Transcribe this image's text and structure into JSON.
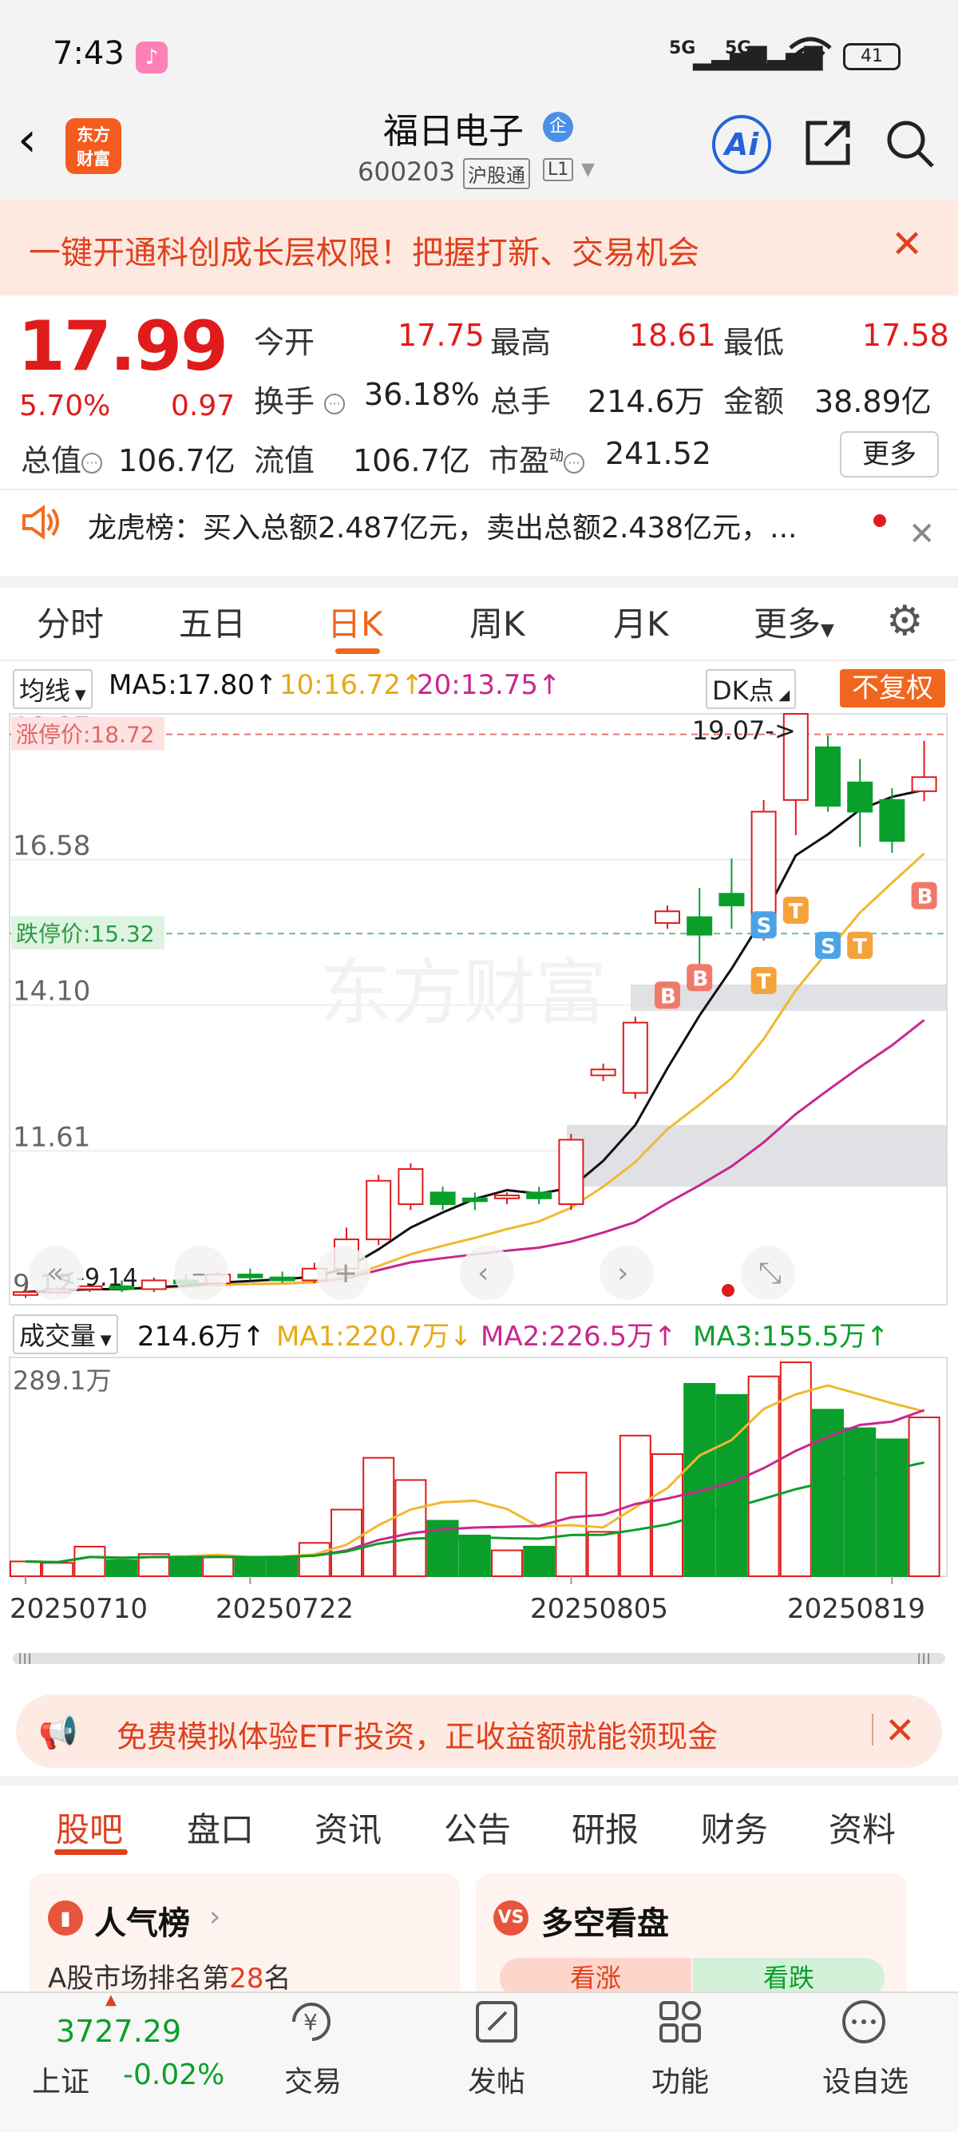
{
  "status": {
    "time": "7:43",
    "signal1": "5G",
    "signal2": "5G",
    "battery": "41"
  },
  "header": {
    "logo_line1": "东方",
    "logo_line2": "财富",
    "stock_name": "福日电子",
    "badge": "企",
    "stock_code": "600203",
    "tag_connect": "沪股通",
    "tag_level": "L1",
    "ai_label": "Ai"
  },
  "promo": {
    "text": "一键开通科创成长层权限！把握打新、交易机会"
  },
  "quote": {
    "price": "17.99",
    "pct_change": "5.70%",
    "change": "0.97",
    "open_label": "今开",
    "open": "17.75",
    "high_label": "最高",
    "high": "18.61",
    "low_label": "最低",
    "low": "17.58",
    "turnover_label": "换手",
    "turnover": "36.18%",
    "volume_label": "总手",
    "volume": "214.6万",
    "amount_label": "金额",
    "amount": "38.89亿",
    "mktcap_label": "总值",
    "mktcap": "106.7亿",
    "float_label": "流值",
    "float_cap": "106.7亿",
    "pe_label": "市盈",
    "pe_sup": "动",
    "pe": "241.52",
    "more_label": "更多"
  },
  "dragon": {
    "text": "龙虎榜：买入总额2.487亿元，卖出总额2.438亿元，..."
  },
  "ktabs": [
    "分时",
    "五日",
    "日K",
    "周K",
    "月K",
    "更多"
  ],
  "indicators": {
    "line_select": "均线",
    "ma5": "MA5:17.80↑",
    "ma10": "10:16.72↑",
    "ma20": "20:13.75↑",
    "dk": "DK点",
    "fq": "不复权"
  },
  "volume_ind": {
    "select": "成交量",
    "vol": "214.6万↑",
    "ma1": "MA1:220.7万↓",
    "ma2": "MA2:226.5万↑",
    "ma3": "MA3:155.5万↑",
    "max_label": "289.1万"
  },
  "chart_data": {
    "type": "candlestick",
    "price_ticks": [
      "19.07",
      "16.58",
      "14.10",
      "11.61",
      "9.12"
    ],
    "limit_up_label": "涨停价:18.72",
    "limit_down_label": "跌停价:15.32",
    "peak_label": "19.07->",
    "low_label": "<-9.14",
    "dates": [
      "20250710",
      "20250722",
      "20250805",
      "20250819"
    ],
    "candles": [
      {
        "o": 9.15,
        "c": 9.2,
        "h": 9.3,
        "l": 9.1,
        "v": 20
      },
      {
        "o": 9.2,
        "c": 9.25,
        "h": 9.3,
        "l": 9.15,
        "v": 18
      },
      {
        "o": 9.25,
        "c": 9.3,
        "h": 9.35,
        "l": 9.2,
        "v": 40
      },
      {
        "o": 9.3,
        "c": 9.25,
        "h": 9.4,
        "l": 9.2,
        "v": 22
      },
      {
        "o": 9.25,
        "c": 9.4,
        "h": 9.45,
        "l": 9.2,
        "v": 30
      },
      {
        "o": 9.4,
        "c": 9.35,
        "h": 9.5,
        "l": 9.3,
        "v": 25
      },
      {
        "o": 9.35,
        "c": 9.5,
        "h": 9.55,
        "l": 9.3,
        "v": 28
      },
      {
        "o": 9.5,
        "c": 9.45,
        "h": 9.6,
        "l": 9.4,
        "v": 24
      },
      {
        "o": 9.45,
        "c": 9.4,
        "h": 9.55,
        "l": 9.35,
        "v": 26
      },
      {
        "o": 9.4,
        "c": 9.6,
        "h": 9.7,
        "l": 9.35,
        "v": 45
      },
      {
        "o": 9.6,
        "c": 10.1,
        "h": 10.3,
        "l": 9.5,
        "v": 90
      },
      {
        "o": 10.1,
        "c": 11.1,
        "h": 11.2,
        "l": 10.0,
        "v": 160
      },
      {
        "o": 10.7,
        "c": 11.3,
        "h": 11.4,
        "l": 10.6,
        "v": 130
      },
      {
        "o": 10.9,
        "c": 10.7,
        "h": 11.0,
        "l": 10.6,
        "v": 75
      },
      {
        "o": 10.8,
        "c": 10.75,
        "h": 10.9,
        "l": 10.6,
        "v": 55
      },
      {
        "o": 10.8,
        "c": 10.85,
        "h": 10.9,
        "l": 10.7,
        "v": 35
      },
      {
        "o": 10.9,
        "c": 10.8,
        "h": 11.0,
        "l": 10.7,
        "v": 40
      },
      {
        "o": 10.7,
        "c": 11.8,
        "h": 11.9,
        "l": 10.6,
        "v": 140
      },
      {
        "o": 12.9,
        "c": 13.0,
        "h": 13.1,
        "l": 12.8,
        "v": 60
      },
      {
        "o": 12.6,
        "c": 13.8,
        "h": 13.9,
        "l": 12.5,
        "v": 190
      },
      {
        "o": 15.5,
        "c": 15.7,
        "h": 15.8,
        "l": 15.4,
        "v": 165
      },
      {
        "o": 15.6,
        "c": 15.3,
        "h": 16.1,
        "l": 14.8,
        "v": 260
      },
      {
        "o": 16.0,
        "c": 15.8,
        "h": 16.6,
        "l": 15.4,
        "v": 245
      },
      {
        "o": 15.3,
        "c": 17.4,
        "h": 17.6,
        "l": 15.2,
        "v": 270
      },
      {
        "o": 17.6,
        "c": 19.07,
        "h": 19.07,
        "l": 17.0,
        "v": 289
      },
      {
        "o": 18.5,
        "c": 17.5,
        "h": 18.7,
        "l": 17.4,
        "v": 225
      },
      {
        "o": 17.9,
        "c": 17.4,
        "h": 18.3,
        "l": 16.8,
        "v": 200
      },
      {
        "o": 17.6,
        "c": 16.9,
        "h": 17.8,
        "l": 16.7,
        "v": 185
      },
      {
        "o": 17.75,
        "c": 17.99,
        "h": 18.61,
        "l": 17.58,
        "v": 214.6
      }
    ],
    "markers": [
      {
        "i": 20,
        "t": "B",
        "price": 14.5
      },
      {
        "i": 21,
        "t": "B",
        "price": 14.8
      },
      {
        "i": 23,
        "t": "T",
        "price": 14.75
      },
      {
        "i": 23,
        "t": "S",
        "price": 15.7
      },
      {
        "i": 24,
        "t": "T",
        "price": 15.95
      },
      {
        "i": 25,
        "t": "S",
        "price": 15.35
      },
      {
        "i": 26,
        "t": "T",
        "price": 15.35
      },
      {
        "i": 28,
        "t": "B",
        "price": 16.2
      }
    ]
  },
  "etf_banner": {
    "text": "免费模拟体验ETF投资，正收益额就能领现金"
  },
  "btabs": [
    "股吧",
    "盘口",
    "资讯",
    "公告",
    "研报",
    "财务",
    "资料"
  ],
  "cards": {
    "left_title": "人气榜",
    "left_sub_prefix": "A股市场排名第",
    "left_rank": "28",
    "left_sub_suffix": "名",
    "right_title": "多空看盘",
    "up": "看涨",
    "down": "看跌"
  },
  "bottom_nav": {
    "index_value": "3727.29",
    "index_name": "上证",
    "index_change": "-0.02%",
    "trade": "交易",
    "post": "发帖",
    "func": "功能",
    "fav": "设自选"
  },
  "colors": {
    "up": "#e01b1b",
    "down": "#0a9f2a",
    "accent": "#f0661e",
    "ma5": "#111111",
    "ma10": "#f2b830",
    "ma20": "#c8278e"
  }
}
